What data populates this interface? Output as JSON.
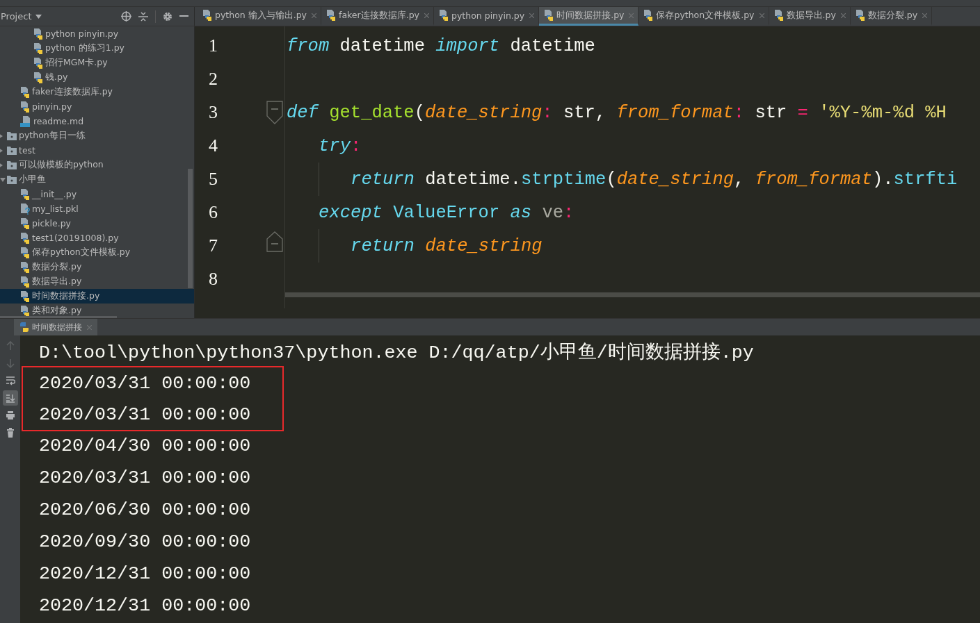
{
  "project_header": {
    "title": "Project"
  },
  "tabs": [
    {
      "label": "python 输入与输出.py",
      "selected": false
    },
    {
      "label": "faker连接数据库.py",
      "selected": false
    },
    {
      "label": "python pinyin.py",
      "selected": false
    },
    {
      "label": "时间数据拼接.py",
      "selected": true
    },
    {
      "label": "保存python文件模板.py",
      "selected": false
    },
    {
      "label": "数据导出.py",
      "selected": false
    },
    {
      "label": "数据分裂.py",
      "selected": false
    }
  ],
  "sidebar": {
    "items": [
      {
        "children": [
          {
            "children": [
              {
                "label": "python pinyin.py",
                "kind": "python",
                "selected": false
              },
              {
                "label": "python 的练习1.py",
                "kind": "python",
                "selected": false
              },
              {
                "label": "招行MGM卡.py",
                "kind": "python",
                "selected": false
              },
              {
                "label": "钱.py",
                "kind": "python",
                "selected": false
              }
            ]
          },
          {
            "label": "faker连接数据库.py",
            "kind": "python",
            "selected": false
          },
          {
            "label": "pinyin.py",
            "kind": "python",
            "selected": false
          },
          {
            "label": "readme.md",
            "kind": "markdown",
            "selected": false
          }
        ]
      },
      {
        "label": "python每日一练",
        "kind": "folder",
        "expanded": false,
        "selected": false
      },
      {
        "label": "test",
        "kind": "folder",
        "expanded": false,
        "selected": false
      },
      {
        "label": "可以做模板的python",
        "kind": "folder",
        "expanded": false,
        "selected": false
      },
      {
        "label": "小甲鱼",
        "kind": "folder",
        "expanded": true,
        "selected": false,
        "children": [
          {
            "label": "__init__.py",
            "kind": "python",
            "selected": false
          },
          {
            "label": "my_list.pkl",
            "kind": "unknown",
            "selected": false
          },
          {
            "label": "pickle.py",
            "kind": "python",
            "selected": false
          },
          {
            "label": "test1(20191008).py",
            "kind": "python",
            "selected": false
          },
          {
            "label": "保存python文件模板.py",
            "kind": "python",
            "selected": false
          },
          {
            "label": "数据分裂.py",
            "kind": "python",
            "selected": false
          },
          {
            "label": "数据导出.py",
            "kind": "python",
            "selected": false
          },
          {
            "label": "时间数据拼接.py",
            "kind": "python",
            "selected": true
          },
          {
            "label": "类和对象.py",
            "kind": "python",
            "selected": false
          }
        ]
      }
    ]
  },
  "editor": {
    "lines": [
      {
        "number": "1",
        "kind": "plain",
        "tokens": [
          {
            "text": "from",
            "kind": "keyword"
          },
          {
            "text": " datetime ",
            "kind": "plain"
          },
          {
            "text": "import",
            "kind": "keyword"
          },
          {
            "text": " datetime",
            "kind": "plain"
          }
        ]
      },
      {
        "number": "2",
        "kind": "plain"
      },
      {
        "number": "3",
        "kind": "block-start",
        "tokens": [
          {
            "text": "def",
            "kind": "keyword"
          },
          {
            "text": " get_date",
            "kind": "function"
          },
          {
            "text": "(",
            "kind": "plain"
          },
          {
            "text": "date_string",
            "kind": "param"
          },
          {
            "text": ":",
            "kind": "operator"
          },
          {
            "text": " str, ",
            "kind": "plain"
          },
          {
            "text": "from_format",
            "kind": "param"
          },
          {
            "text": ":",
            "kind": "operator"
          },
          {
            "text": " str ",
            "kind": "plain"
          },
          {
            "text": "=",
            "kind": "operator"
          },
          {
            "text": " '%Y-%m-%d %H",
            "kind": "string"
          }
        ],
        "children": [
          {
            "number": "4",
            "kind": "plain",
            "tokens": [
              {
                "text": "try",
                "kind": "keyword"
              },
              {
                "text": ":",
                "kind": "operator"
              }
            ],
            "children": [
              {
                "number": "5",
                "kind": "plain",
                "tokens": [
                  {
                    "text": "return",
                    "kind": "keyword"
                  },
                  {
                    "text": " datetime.",
                    "kind": "plain"
                  },
                  {
                    "text": "strptime",
                    "kind": "method"
                  },
                  {
                    "text": "(",
                    "kind": "plain"
                  },
                  {
                    "text": "date_string",
                    "kind": "param"
                  },
                  {
                    "text": ", ",
                    "kind": "plain"
                  },
                  {
                    "text": "from_format",
                    "kind": "param"
                  },
                  {
                    "text": ").",
                    "kind": "plain"
                  },
                  {
                    "text": "strfti",
                    "kind": "method"
                  }
                ]
              }
            ]
          },
          {
            "number": "6",
            "kind": "plain",
            "tokens": [
              {
                "text": "except",
                "kind": "keyword"
              },
              {
                "text": " ValueError ",
                "kind": "method"
              },
              {
                "text": "as",
                "kind": "keyword"
              },
              {
                "text": " ve",
                "kind": "name"
              },
              {
                "text": ":",
                "kind": "operator"
              }
            ],
            "children": [
              {
                "number": "7",
                "kind": "block-end",
                "tokens": [
                  {
                    "text": "return",
                    "kind": "keyword"
                  },
                  {
                    "text": " date_string",
                    "kind": "param"
                  }
                ]
              }
            ]
          }
        ]
      },
      {
        "number": "8",
        "kind": "plain"
      }
    ]
  },
  "run_tabs": [
    {
      "label": "时间数据拼接",
      "selected": true
    }
  ],
  "run_toolbar": [
    {
      "kind": "up",
      "disabled": true,
      "on": false
    },
    {
      "kind": "down",
      "disabled": true,
      "on": false
    },
    {
      "kind": "wrap",
      "disabled": false,
      "on": false
    },
    {
      "kind": "scroll-end",
      "disabled": false,
      "on": true
    },
    {
      "kind": "print",
      "disabled": false,
      "on": false
    },
    {
      "kind": "trash",
      "disabled": false,
      "on": false
    }
  ],
  "output": [
    {
      "text": "D:\\tool\\python\\python37\\python.exe D:/qq/atp/小甲鱼/时间数据拼接.py",
      "highlighted": false
    },
    {
      "text": "2020/03/31 00:00:00",
      "highlighted": true
    },
    {
      "text": "2020/03/31 00:00:00",
      "highlighted": true
    },
    {
      "text": "2020/04/30 00:00:00",
      "highlighted": false
    },
    {
      "text": "2020/03/31 00:00:00",
      "highlighted": false
    },
    {
      "text": "2020/06/30 00:00:00",
      "highlighted": false
    },
    {
      "text": "2020/09/30 00:00:00",
      "highlighted": false
    },
    {
      "text": "2020/12/31 00:00:00",
      "highlighted": false
    },
    {
      "text": "2020/12/31 00:00:00",
      "highlighted": false
    }
  ]
}
